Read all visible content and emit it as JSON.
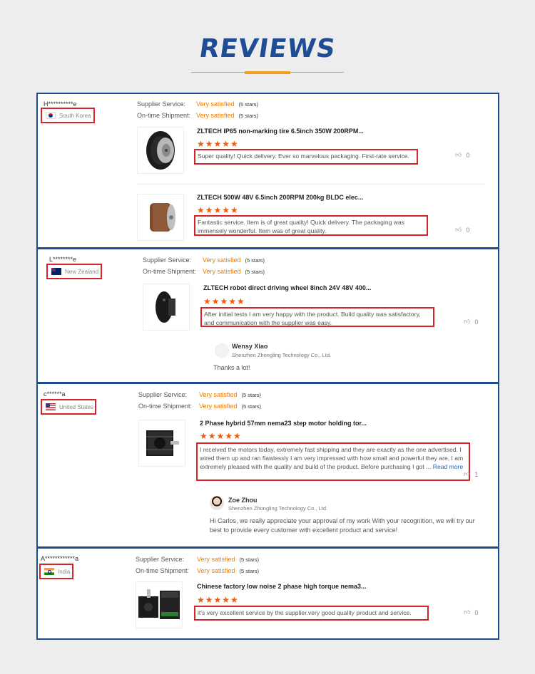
{
  "header": {
    "title": "REVIEWS"
  },
  "labels": {
    "supplier_service": "Supplier Service:",
    "on_time_shipment": "On-time Shipment:",
    "very_satisfied": "Very satisfied",
    "five_stars": "(5 stars)"
  },
  "colors": {
    "accent": "#f07c00",
    "border": "#1f4a8c",
    "highlight": "#d8232a",
    "title": "#1e4d95"
  },
  "reviews": [
    {
      "user": "H**********e",
      "country": "South Korea",
      "flag_icon": "south-korea-flag-icon",
      "products": [
        {
          "name": "ZLTECH IP65 non-marking tire 6.5inch 350W 200RPM...",
          "rating": 5,
          "text": "Super quality! Quick delivery. Ever so marvelous packaging. First-rate service.",
          "likes": "0"
        },
        {
          "name": "ZLTECH 500W 48V 6.5inch 200RPM 200kg BLDC elec...",
          "rating": 5,
          "text": "Fantastic service. Item is of great quality! Quick delivery. The packaging was immensely wonderful. Item was of great quality.",
          "likes": "0"
        }
      ]
    },
    {
      "user": "L********e",
      "country": "New Zealand",
      "flag_icon": "new-zealand-flag-icon",
      "products": [
        {
          "name": "ZLTECH robot direct driving wheel 8inch 24V 48V 400...",
          "rating": 5,
          "text": "After initial tests I am very happy with the product. Build quality was satisfactory, and communication with the supplier was easy.",
          "likes": "0"
        }
      ],
      "reply": {
        "name": "Wensy Xiao",
        "company": "Shenzhen Zhongling Technology Co., Ltd.",
        "text": "Thanks a lot!"
      }
    },
    {
      "user": "c******a",
      "country": "United States",
      "flag_icon": "united-states-flag-icon",
      "products": [
        {
          "name": "2 Phase hybrid 57mm nema23 step motor holding tor...",
          "rating": 5,
          "text": "I received the motors today, extremely fast shipping and they are exactly as the one advertised. I wired them up and ran flawlessly I am very impressed with how small and powerful they are, I am extremely pleased with the quality and build of the product. Before purchasing I got ...",
          "read_more": "Read more",
          "likes": "1"
        }
      ],
      "reply": {
        "name": "Zoe Zhou",
        "company": "Shenzhen Zhongling Technology Co., Ltd.",
        "text": "Hi Carlos, we really appreciate your approval of my work  With your recognition, we will try our best to provide every customer with excellent product and service!"
      }
    },
    {
      "user": "A************a",
      "country": "India",
      "flag_icon": "india-flag-icon",
      "products": [
        {
          "name": "Chinese factory low noise 2 phase high torque nema3...",
          "rating": 5,
          "text": "it's very excellent service by the supplier.very good quality product and service.",
          "likes": "0"
        }
      ]
    }
  ]
}
